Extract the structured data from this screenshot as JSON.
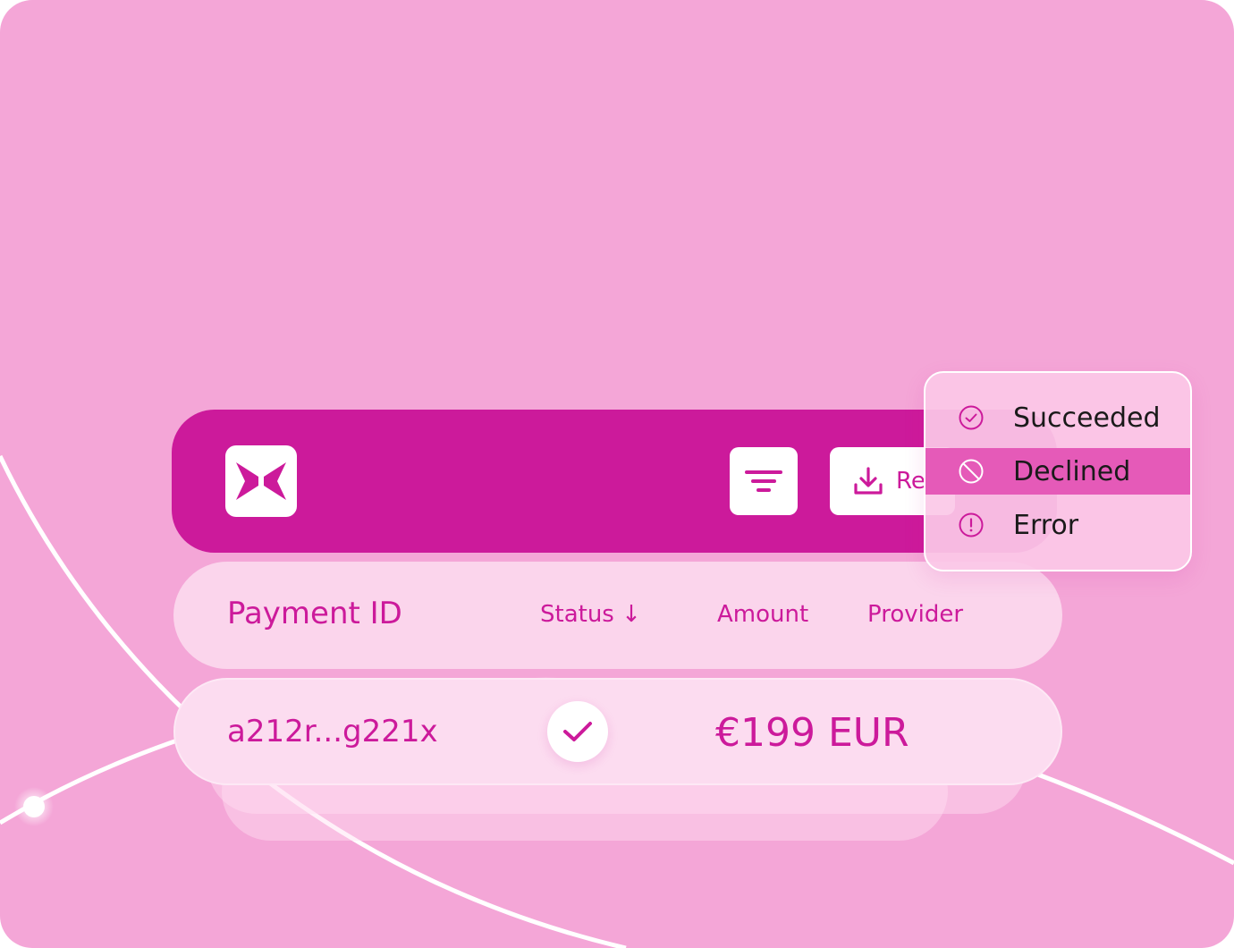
{
  "colors": {
    "background": "#f4a6d7",
    "brand": "#cc1a9b",
    "row": "#fbd5ec",
    "dropdown_selected": "#e55ab8"
  },
  "toolbar": {
    "logo_icon": "butterfly-logo-icon",
    "filter_icon": "filter-icon",
    "report_icon": "download-icon",
    "report_label": "Re"
  },
  "table": {
    "columns": [
      "Payment ID",
      "Status ↓",
      "Amount",
      "Provider"
    ],
    "rows": [
      {
        "payment_id": "a212r...g221x",
        "status_icon": "checkmark-icon",
        "amount": "€199 EUR",
        "provider": ""
      }
    ]
  },
  "status_filter": {
    "options": [
      {
        "label": "Succeeded",
        "icon": "check-circle-icon",
        "selected": false
      },
      {
        "label": "Declined",
        "icon": "ban-icon",
        "selected": true
      },
      {
        "label": "Error",
        "icon": "alert-circle-icon",
        "selected": false
      }
    ]
  }
}
